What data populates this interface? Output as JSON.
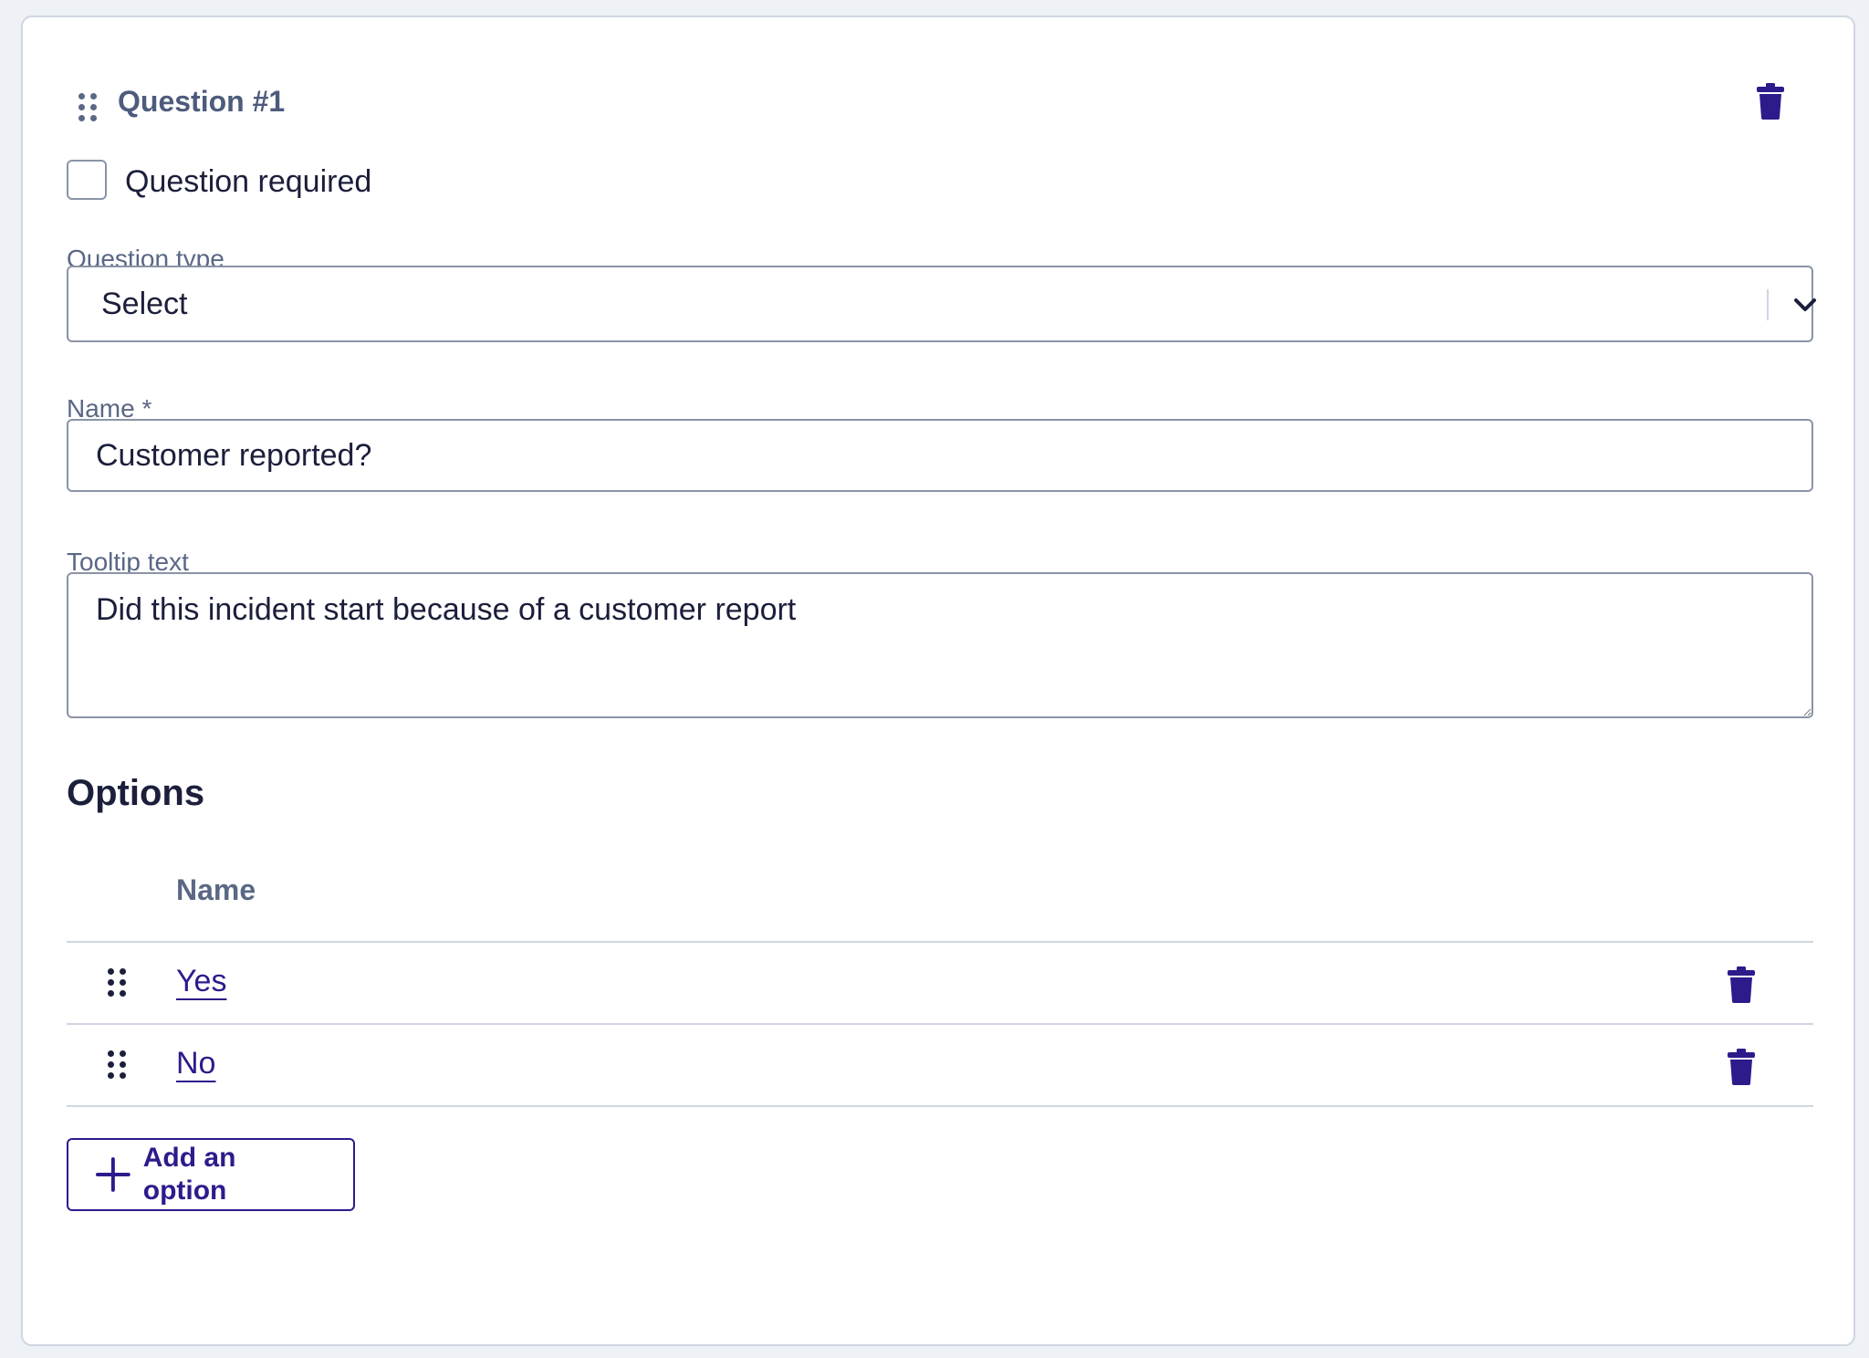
{
  "question": {
    "title": "Question #1",
    "required_label": "Question required",
    "required_checked": false
  },
  "fields": {
    "question_type_label": "Question type",
    "question_type_value": "Select",
    "name_label": "Name *",
    "name_value": "Customer reported?",
    "tooltip_label": "Tooltip text",
    "tooltip_value": "Did this incident start because of a customer report"
  },
  "options": {
    "heading": "Options",
    "column_header": "Name",
    "items": [
      {
        "label": "Yes"
      },
      {
        "label": "No"
      }
    ],
    "add_label": "Add an option"
  },
  "icons": {
    "drag_handle": "drag-handle-icon",
    "trash": "trash-icon",
    "chevron": "chevron-down-icon",
    "plus": "plus-icon"
  },
  "colors": {
    "accent": "#2d1b8c",
    "title_text": "#4d5b7c",
    "muted_label": "#5a6785",
    "border": "#8a94a6",
    "divider": "#cfd6e0",
    "background": "#eef1f5",
    "drag_dots_header": "#5a6785",
    "drag_dots_row": "#1b1f3b"
  }
}
